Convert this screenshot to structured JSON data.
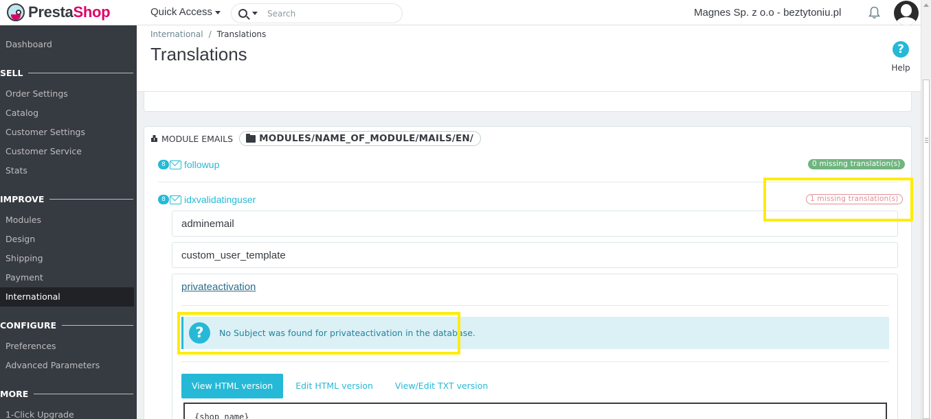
{
  "app": {
    "logo_left": "Presta",
    "logo_right": "Shop",
    "quick_access": "Quick Access",
    "search_placeholder": "Search",
    "shop_name": "Magnes Sp. z o.o - beztytoniu.pl"
  },
  "sidebar": {
    "items": [
      {
        "label": "Dashboard"
      },
      {
        "section": "SELL"
      },
      {
        "label": "Order Settings"
      },
      {
        "label": "Catalog"
      },
      {
        "label": "Customer Settings"
      },
      {
        "label": "Customer Service"
      },
      {
        "label": "Stats"
      },
      {
        "section": "IMPROVE"
      },
      {
        "label": "Modules"
      },
      {
        "label": "Design"
      },
      {
        "label": "Shipping"
      },
      {
        "label": "Payment"
      },
      {
        "label": "International",
        "active": true
      },
      {
        "section": "CONFIGURE"
      },
      {
        "label": "Preferences"
      },
      {
        "label": "Advanced Parameters"
      },
      {
        "section": "MORE"
      },
      {
        "label": "1-Click Upgrade"
      }
    ]
  },
  "header": {
    "breadcrumb": [
      "International",
      "Translations"
    ],
    "title": "Translations",
    "help_label": "Help",
    "help_glyph": "?"
  },
  "module_emails": {
    "heading": "MODULE EMAILS",
    "path": "MODULES/NAME_OF_MODULE/MAILS/EN/",
    "groups": [
      {
        "count": "8",
        "name": "followup",
        "missing": "0 missing translation(s)"
      },
      {
        "count": "8",
        "name": "idxvalidatinguser",
        "missing": "1 missing translation(s)"
      }
    ],
    "templates": [
      "adminemail",
      "custom_user_template",
      "privateactivation"
    ],
    "alert": "No Subject was found for privateactivation in the database.",
    "alert_glyph": "?",
    "tabs": [
      "View HTML version",
      "Edit HTML version",
      "View/Edit TXT version"
    ],
    "editor_text": "{shop_name}"
  },
  "colors": {
    "accent": "#25b9d7",
    "sidebar_bg": "#363a41",
    "success": "#70b580",
    "danger": "#e08f95",
    "highlight": "#ffec00"
  }
}
